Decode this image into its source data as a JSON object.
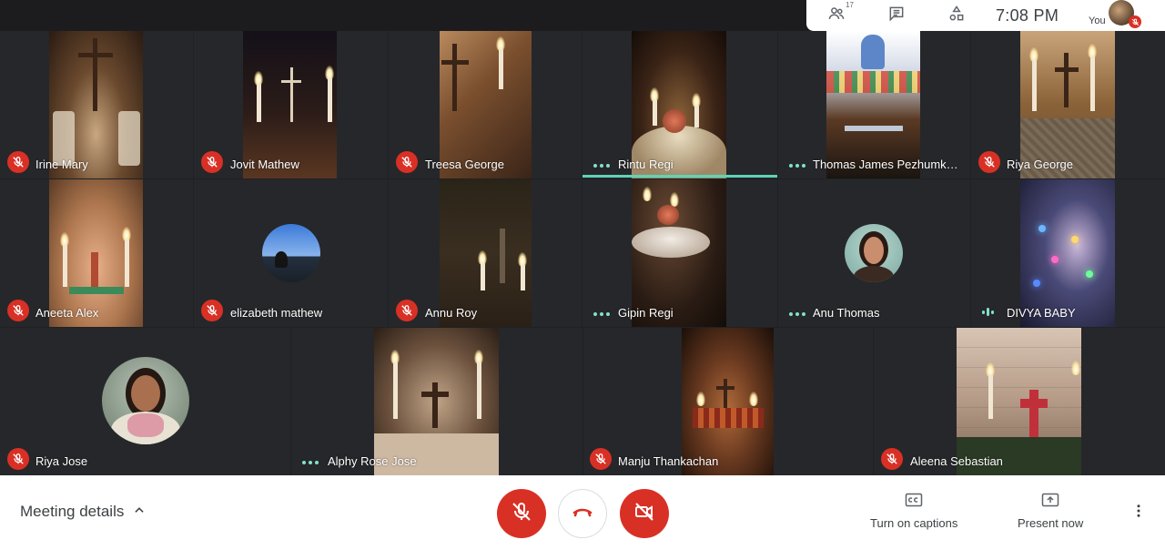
{
  "topbar": {
    "participants_count": "17",
    "people_icon": "people-icon",
    "chat_icon": "chat-icon",
    "activities_icon": "activities-icon",
    "clock": "7:08  PM",
    "you_label": "You"
  },
  "tiles": [
    {
      "name": "Irine Mary",
      "status": "muted"
    },
    {
      "name": "Jovit Mathew",
      "status": "muted"
    },
    {
      "name": "Treesa George",
      "status": "muted"
    },
    {
      "name": "Rintu Regi",
      "status": "speaking"
    },
    {
      "name": "Thomas James Pezhumka...",
      "status": "idle"
    },
    {
      "name": "Riya George",
      "status": "muted"
    },
    {
      "name": "Aneeta Alex",
      "status": "muted"
    },
    {
      "name": "elizabeth mathew",
      "status": "muted"
    },
    {
      "name": "Annu Roy",
      "status": "muted"
    },
    {
      "name": "Gipin Regi",
      "status": "idle"
    },
    {
      "name": "Anu Thomas",
      "status": "idle"
    },
    {
      "name": "DIVYA BABY",
      "status": "audio-level"
    },
    {
      "name": "Riya Jose",
      "status": "muted"
    },
    {
      "name": "Alphy Rose Jose",
      "status": "idle"
    },
    {
      "name": "Manju Thankachan",
      "status": "muted"
    },
    {
      "name": "Aleena Sebastian",
      "status": "muted"
    }
  ],
  "bottombar": {
    "meeting_details": "Meeting details",
    "captions_label": "Turn on captions",
    "present_label": "Present now"
  },
  "colors": {
    "mute_red": "#d93025",
    "speaking_green": "#81e2c9",
    "background": "#202124"
  }
}
